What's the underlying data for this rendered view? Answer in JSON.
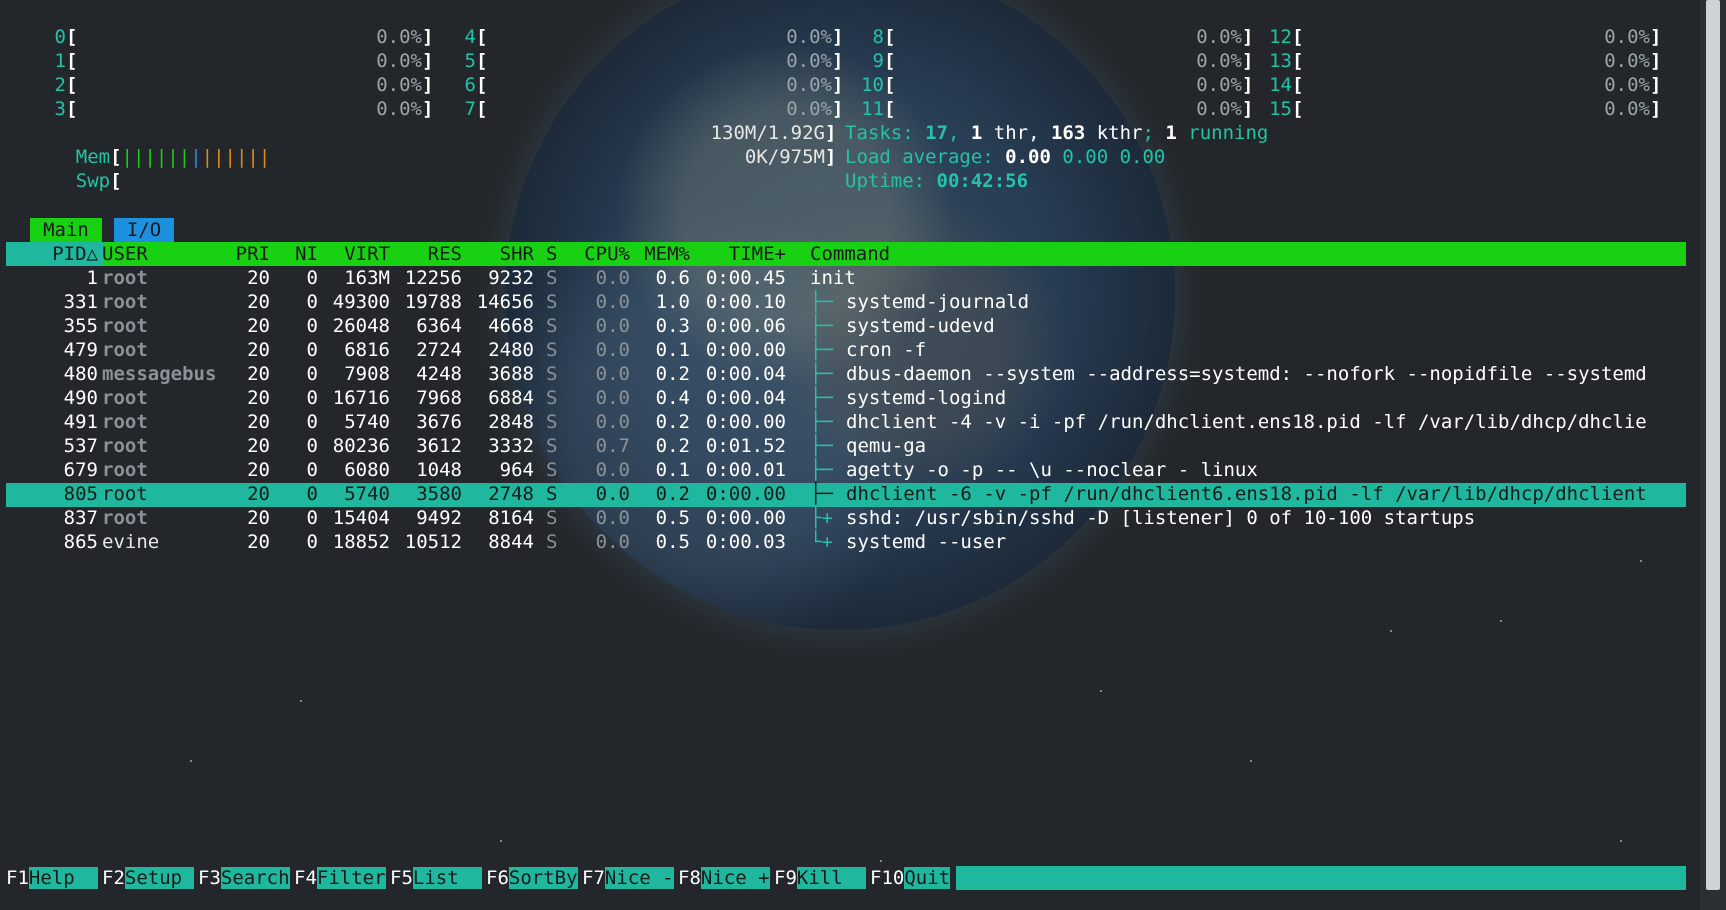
{
  "cpus": [
    {
      "id": "0",
      "pct": "0.0%"
    },
    {
      "id": "1",
      "pct": "0.0%"
    },
    {
      "id": "2",
      "pct": "0.0%"
    },
    {
      "id": "3",
      "pct": "0.0%"
    },
    {
      "id": "4",
      "pct": "0.0%"
    },
    {
      "id": "5",
      "pct": "0.0%"
    },
    {
      "id": "6",
      "pct": "0.0%"
    },
    {
      "id": "7",
      "pct": "0.0%"
    },
    {
      "id": "8",
      "pct": "0.0%"
    },
    {
      "id": "9",
      "pct": "0.0%"
    },
    {
      "id": "10",
      "pct": "0.0%"
    },
    {
      "id": "11",
      "pct": "0.0%"
    },
    {
      "id": "12",
      "pct": "0.0%"
    },
    {
      "id": "13",
      "pct": "0.0%"
    },
    {
      "id": "14",
      "pct": "0.0%"
    },
    {
      "id": "15",
      "pct": "0.0%"
    }
  ],
  "mem": {
    "label": "Mem",
    "value": "130M/1.92G"
  },
  "swp": {
    "label": "Swp",
    "value": "0K/975M"
  },
  "tasks": {
    "label": "Tasks: ",
    "count": "17",
    "sep1": ", ",
    "thr": "1",
    "thr_label": " thr, ",
    "kthr": "163",
    "kthr_label": " kthr",
    "sep2": "; ",
    "running": "1",
    "running_label": " running"
  },
  "load": {
    "label": "Load average: ",
    "v1": "0.00",
    "v2": "0.00",
    "v3": "0.00"
  },
  "uptime": {
    "label": "Uptime: ",
    "value": "00:42:56"
  },
  "tabs": {
    "main": "Main",
    "io": "I/O"
  },
  "columns": {
    "pid": "PID△",
    "user": "USER",
    "pri": "PRI",
    "ni": "NI",
    "virt": "VIRT",
    "res": "RES",
    "shr": "SHR",
    "s": "S",
    "cpu": "CPU%",
    "mem": "MEM%",
    "time": "TIME+",
    "command": "Command"
  },
  "processes": [
    {
      "pid": "1",
      "user": "root",
      "pri": "20",
      "ni": "0",
      "virt": "163M",
      "res": "12256",
      "shr": "9232",
      "s": "S",
      "cpu": "0.0",
      "mem": "0.6",
      "time": "0:00.45",
      "tree": "",
      "cmd": "init"
    },
    {
      "pid": "331",
      "user": "root",
      "pri": "20",
      "ni": "0",
      "virt": "49300",
      "res": "19788",
      "shr": "14656",
      "s": "S",
      "cpu": "0.0",
      "mem": "1.0",
      "time": "0:00.10",
      "tree": "├─ ",
      "cmd": "systemd-journald"
    },
    {
      "pid": "355",
      "user": "root",
      "pri": "20",
      "ni": "0",
      "virt": "26048",
      "res": "6364",
      "shr": "4668",
      "s": "S",
      "cpu": "0.0",
      "mem": "0.3",
      "time": "0:00.06",
      "tree": "├─ ",
      "cmd": "systemd-udevd"
    },
    {
      "pid": "479",
      "user": "root",
      "pri": "20",
      "ni": "0",
      "virt": "6816",
      "res": "2724",
      "shr": "2480",
      "s": "S",
      "cpu": "0.0",
      "mem": "0.1",
      "time": "0:00.00",
      "tree": "├─ ",
      "cmd": "cron -f"
    },
    {
      "pid": "480",
      "user": "messagebus",
      "pri": "20",
      "ni": "0",
      "virt": "7908",
      "res": "4248",
      "shr": "3688",
      "s": "S",
      "cpu": "0.0",
      "mem": "0.2",
      "time": "0:00.04",
      "tree": "├─ ",
      "cmd": "dbus-daemon --system --address=systemd: --nofork --nopidfile --systemd"
    },
    {
      "pid": "490",
      "user": "root",
      "pri": "20",
      "ni": "0",
      "virt": "16716",
      "res": "7968",
      "shr": "6884",
      "s": "S",
      "cpu": "0.0",
      "mem": "0.4",
      "time": "0:00.04",
      "tree": "├─ ",
      "cmd": "systemd-logind"
    },
    {
      "pid": "491",
      "user": "root",
      "pri": "20",
      "ni": "0",
      "virt": "5740",
      "res": "3676",
      "shr": "2848",
      "s": "S",
      "cpu": "0.0",
      "mem": "0.2",
      "time": "0:00.00",
      "tree": "├─ ",
      "cmd": "dhclient -4 -v -i -pf /run/dhclient.ens18.pid -lf /var/lib/dhcp/dhclie"
    },
    {
      "pid": "537",
      "user": "root",
      "pri": "20",
      "ni": "0",
      "virt": "80236",
      "res": "3612",
      "shr": "3332",
      "s": "S",
      "cpu": "0.7",
      "mem": "0.2",
      "time": "0:01.52",
      "tree": "├─ ",
      "cmd": "qemu-ga"
    },
    {
      "pid": "679",
      "user": "root",
      "pri": "20",
      "ni": "0",
      "virt": "6080",
      "res": "1048",
      "shr": "964",
      "s": "S",
      "cpu": "0.0",
      "mem": "0.1",
      "time": "0:00.01",
      "tree": "├─ ",
      "cmd": "agetty -o -p -- \\u --noclear - linux"
    },
    {
      "pid": "805",
      "user": "root",
      "pri": "20",
      "ni": "0",
      "virt": "5740",
      "res": "3580",
      "shr": "2748",
      "s": "S",
      "cpu": "0.0",
      "mem": "0.2",
      "time": "0:00.00",
      "tree": "├─ ",
      "cmd": "dhclient -6 -v -pf /run/dhclient6.ens18.pid -lf /var/lib/dhcp/dhclient"
    },
    {
      "pid": "837",
      "user": "root",
      "pri": "20",
      "ni": "0",
      "virt": "15404",
      "res": "9492",
      "shr": "8164",
      "s": "S",
      "cpu": "0.0",
      "mem": "0.5",
      "time": "0:00.00",
      "tree": "├+ ",
      "cmd": "sshd: /usr/sbin/sshd -D [listener] 0 of 10-100 startups"
    },
    {
      "pid": "865",
      "user": "evine",
      "pri": "20",
      "ni": "0",
      "virt": "18852",
      "res": "10512",
      "shr": "8844",
      "s": "S",
      "cpu": "0.0",
      "mem": "0.5",
      "time": "0:00.03",
      "tree": "└+ ",
      "cmd": "systemd --user"
    }
  ],
  "fkeys": [
    {
      "key": "F1",
      "label": "Help  "
    },
    {
      "key": "F2",
      "label": "Setup "
    },
    {
      "key": "F3",
      "label": "Search"
    },
    {
      "key": "F4",
      "label": "Filter"
    },
    {
      "key": "F5",
      "label": "List  "
    },
    {
      "key": "F6",
      "label": "SortBy"
    },
    {
      "key": "F7",
      "label": "Nice -"
    },
    {
      "key": "F8",
      "label": "Nice +"
    },
    {
      "key": "F9",
      "label": "Kill  "
    },
    {
      "key": "F10",
      "label": "Quit"
    }
  ],
  "selected_pid": "805",
  "colors": {
    "accent": "#23c3a6",
    "header": "#17d112",
    "selected": "#1fb89e",
    "io_tab": "#1e90e0"
  }
}
